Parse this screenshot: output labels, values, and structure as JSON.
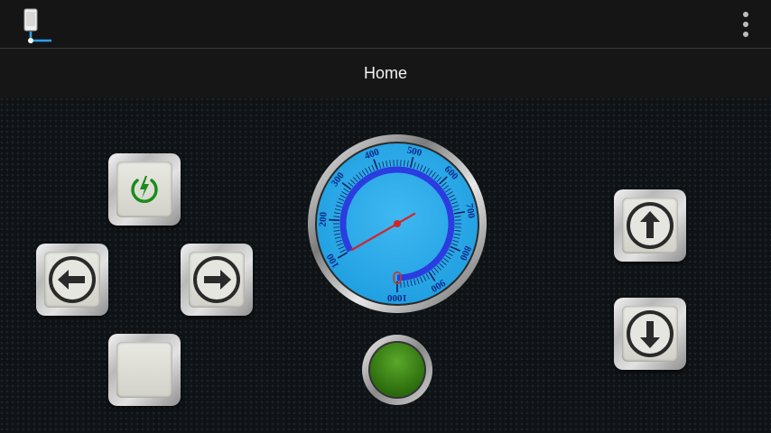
{
  "app": {
    "title": "Home",
    "menu_icon": "more-vertical-icon",
    "device_icon": "device-connection-icon"
  },
  "controls": {
    "power": {
      "icon": "power-icon",
      "color": "#1a8c1a"
    },
    "left": {
      "icon": "arrow-left-icon"
    },
    "right": {
      "icon": "arrow-right-icon"
    },
    "stop": {
      "icon": "blank-square"
    },
    "up": {
      "icon": "arrow-up-icon"
    },
    "down": {
      "icon": "arrow-down-icon"
    }
  },
  "gauge": {
    "value": "0",
    "needle_value": 100,
    "min": 100,
    "max": 1000,
    "tick_labels": [
      "100",
      "200",
      "300",
      "400",
      "500",
      "600",
      "700",
      "800",
      "900",
      "1000"
    ],
    "face_color": "#1ea4e6",
    "arc_color": "#2b3ce0",
    "label_color": "#102a8a"
  },
  "indicator": {
    "state": "on",
    "color": "#2f7a12"
  }
}
